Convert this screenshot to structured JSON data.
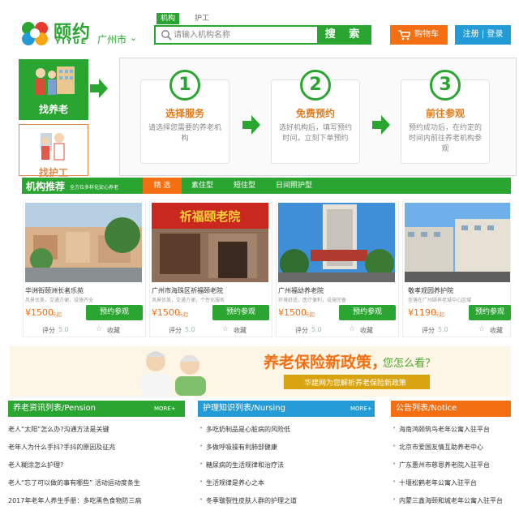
{
  "header": {
    "logo_cn": "颐约",
    "logo_en": "YIYUE",
    "city": "广州市",
    "search_tabs": [
      "机构",
      "护工"
    ],
    "search_placeholder": "请输入机构名称",
    "search_button": "搜 索",
    "cart_button": "购物车",
    "login": "注册 | 登录"
  },
  "side": {
    "find_label": "找养老",
    "find2_label": "找护工"
  },
  "steps": [
    {
      "num": "1",
      "title": "选择服务",
      "desc": "请选择您需要的养老机构"
    },
    {
      "num": "2",
      "title": "免费预约",
      "desc": "选好机构后，填写预约时间，立刻下单预约"
    },
    {
      "num": "3",
      "title": "前往参观",
      "desc": "预约成功后，在约定的时间内前往养老机构参观"
    }
  ],
  "recommend": {
    "title": "机构推荐",
    "subtitle": "全方位多样化安心养老",
    "tabs": [
      "精 选",
      "素住型",
      "短住型",
      "日间照护型"
    ]
  },
  "cards": [
    {
      "name": "华洲街颐洲长者乐苑",
      "desc": "风景优美，交通方便，设施齐全",
      "price": "¥1500",
      "unit": "元起",
      "book": "预约参观",
      "rating_label": "评分",
      "rating": "5.0",
      "fav": "收藏"
    },
    {
      "name": "广州市海珠区祈福颐老院",
      "desc": "风景优美，交通方便，个性化服务",
      "price": "¥1500",
      "unit": "元起",
      "book": "预约参观",
      "rating_label": "评分",
      "rating": "5.0",
      "fav": "收藏"
    },
    {
      "name": "广州福幼养老院",
      "desc": "环境舒适，医疗便利，设施完备",
      "price": "¥1500",
      "unit": "元起",
      "book": "预约参观",
      "rating_label": "评分",
      "rating": "5.0",
      "fav": "收藏"
    },
    {
      "name": "敬孝观园养护院",
      "desc": "坐落在广州颐养老城中心区域",
      "price": "¥1190",
      "unit": "元起",
      "book": "预约参观",
      "rating_label": "评分",
      "rating": "5.0",
      "fav": "收藏"
    }
  ],
  "banner": {
    "title": "养老保险新政策，",
    "question": "您怎么看？",
    "sub": "华建网为您解析养老保险新政策"
  },
  "lists": [
    {
      "title": "养老资讯列表/Pension",
      "more": "MORE+",
      "items": [
        "老人“太阳”怎么办?沟通方法是关键",
        "老年人为什么手抖?手抖的原因及征兆",
        "老人糊涂怎么护理?",
        "老人“忘了可以做的事有哪些” 活动运动度条生",
        "2017年老年人养生手册：多吃黑色食物防三病"
      ]
    },
    {
      "title": "护理知识列表/Nursing",
      "more": "MORE+",
      "items": [
        "多吃奶制品是心脏病的风险低",
        "多做呼吸操有利肺部健康",
        "糖尿病的生活规律和治疗法",
        "生活规律是养心之本",
        "冬季皲裂性皮肤人群的护理之道"
      ]
    },
    {
      "title": "公告列表/Notice",
      "more": "",
      "items": [
        "海南鸿颐筑鸟老年公寓入驻平台",
        "北京市爱国友情互助养老中心",
        "广东惠州市慈恩养老院入驻平台",
        "十堰松鹤老年公寓入驻平台",
        "内蒙三鑫海颐和城老年公寓入驻平台"
      ]
    }
  ],
  "colors": {
    "green": "#2aa531",
    "orange": "#f46e12",
    "blue": "#239bd6"
  }
}
